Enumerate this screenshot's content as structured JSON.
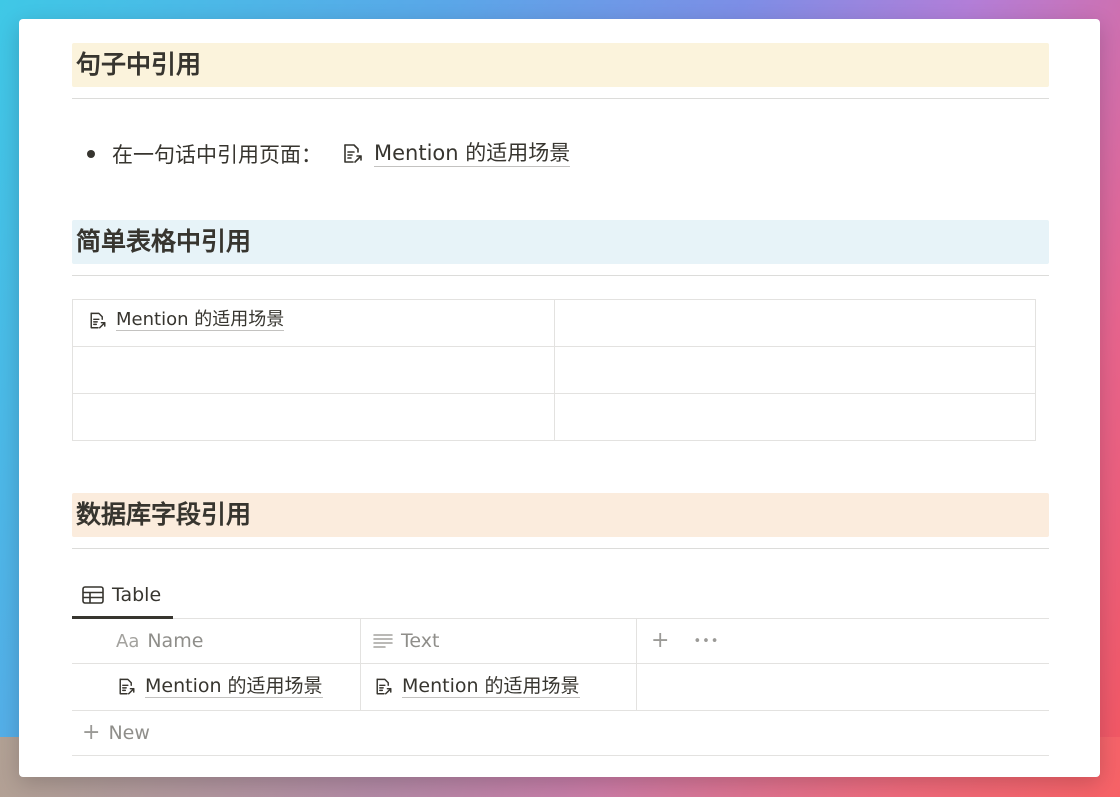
{
  "sections": {
    "sentence": {
      "heading": "句子中引用",
      "heading_bg": "#fbf3dc",
      "bullet_text": "在一句话中引用页面：",
      "mention": "Mention 的适用场景"
    },
    "simple_table": {
      "heading": "简单表格中引用",
      "heading_bg": "#e7f3f8",
      "rows": [
        [
          "Mention 的适用场景",
          ""
        ],
        [
          "",
          ""
        ],
        [
          "",
          ""
        ]
      ]
    },
    "database": {
      "heading": "数据库字段引用",
      "heading_bg": "#fbecdd",
      "view_tab": "Table",
      "columns": [
        {
          "label": "Name",
          "prefix": "Aa",
          "icon": "title-property-icon"
        },
        {
          "label": "Text",
          "icon": "text-lines-icon"
        }
      ],
      "add_column": "+",
      "more": "•••",
      "rows": [
        {
          "name": "Mention 的适用场景",
          "text": "Mention 的适用场景"
        }
      ],
      "new_row_label": "New"
    }
  },
  "icons": {
    "mention": "page-mention-icon",
    "table_view": "table-icon",
    "plus": "plus-icon",
    "more": "more-icon"
  }
}
